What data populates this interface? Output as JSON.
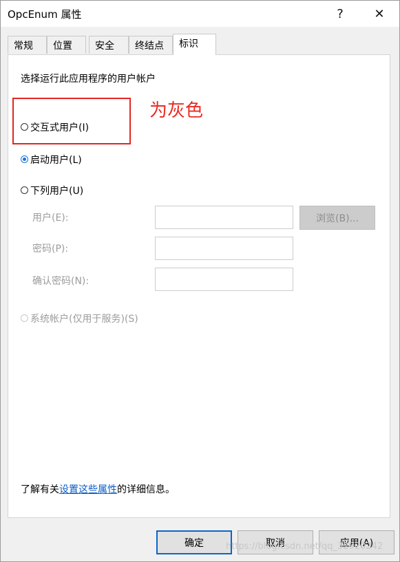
{
  "window": {
    "title": "OpcEnum 属性",
    "help": "?",
    "close": "✕"
  },
  "tabs": [
    {
      "label": "常规"
    },
    {
      "label": "位置"
    },
    {
      "label": "安全"
    },
    {
      "label": "终结点"
    },
    {
      "label": "标识",
      "active": true
    }
  ],
  "identity": {
    "heading": "选择运行此应用程序的用户帐户",
    "options": [
      {
        "label": "交互式用户(I)",
        "checked": false,
        "enabled": true
      },
      {
        "label": "启动用户(L)",
        "checked": true,
        "enabled": true
      },
      {
        "label": "下列用户(U)",
        "checked": false,
        "enabled": true
      },
      {
        "label": "系统帐户(仅用于服务)(S)",
        "checked": false,
        "enabled": false
      }
    ],
    "user_label": "用户(E):",
    "user_value": "",
    "password_label": "密码(P):",
    "password_value": "",
    "confirm_label": "确认密码(N):",
    "confirm_value": "",
    "browse_label": "浏览(B)..."
  },
  "footer_info": {
    "prefix": "了解有关",
    "link": "设置这些属性",
    "suffix": "的详细信息。"
  },
  "buttons": {
    "ok": "确定",
    "cancel": "取消",
    "apply": "应用(A)"
  },
  "annotation": {
    "text": "为灰色",
    "color": "#ea2b22"
  },
  "watermark": "https://blog.csdn.net/qq_32920242"
}
